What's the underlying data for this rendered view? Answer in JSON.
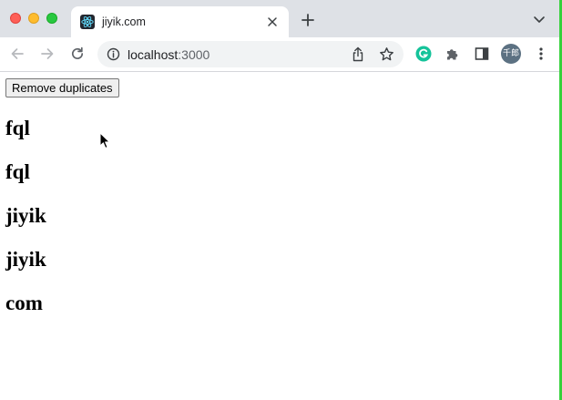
{
  "browser": {
    "tab": {
      "title": "jiyik.com",
      "favicon": "react-icon"
    },
    "omnibox": {
      "host": "localhost",
      "port": ":3000"
    },
    "profile": {
      "initials": "千郎"
    },
    "colors": {
      "tabstrip": "#dee1e6",
      "omnibox": "#f1f3f4",
      "edge_highlight": "#35d13a"
    }
  },
  "page": {
    "button_label": "Remove duplicates",
    "items": [
      "fql",
      "fql",
      "jiyik",
      "jiyik",
      "com"
    ]
  }
}
